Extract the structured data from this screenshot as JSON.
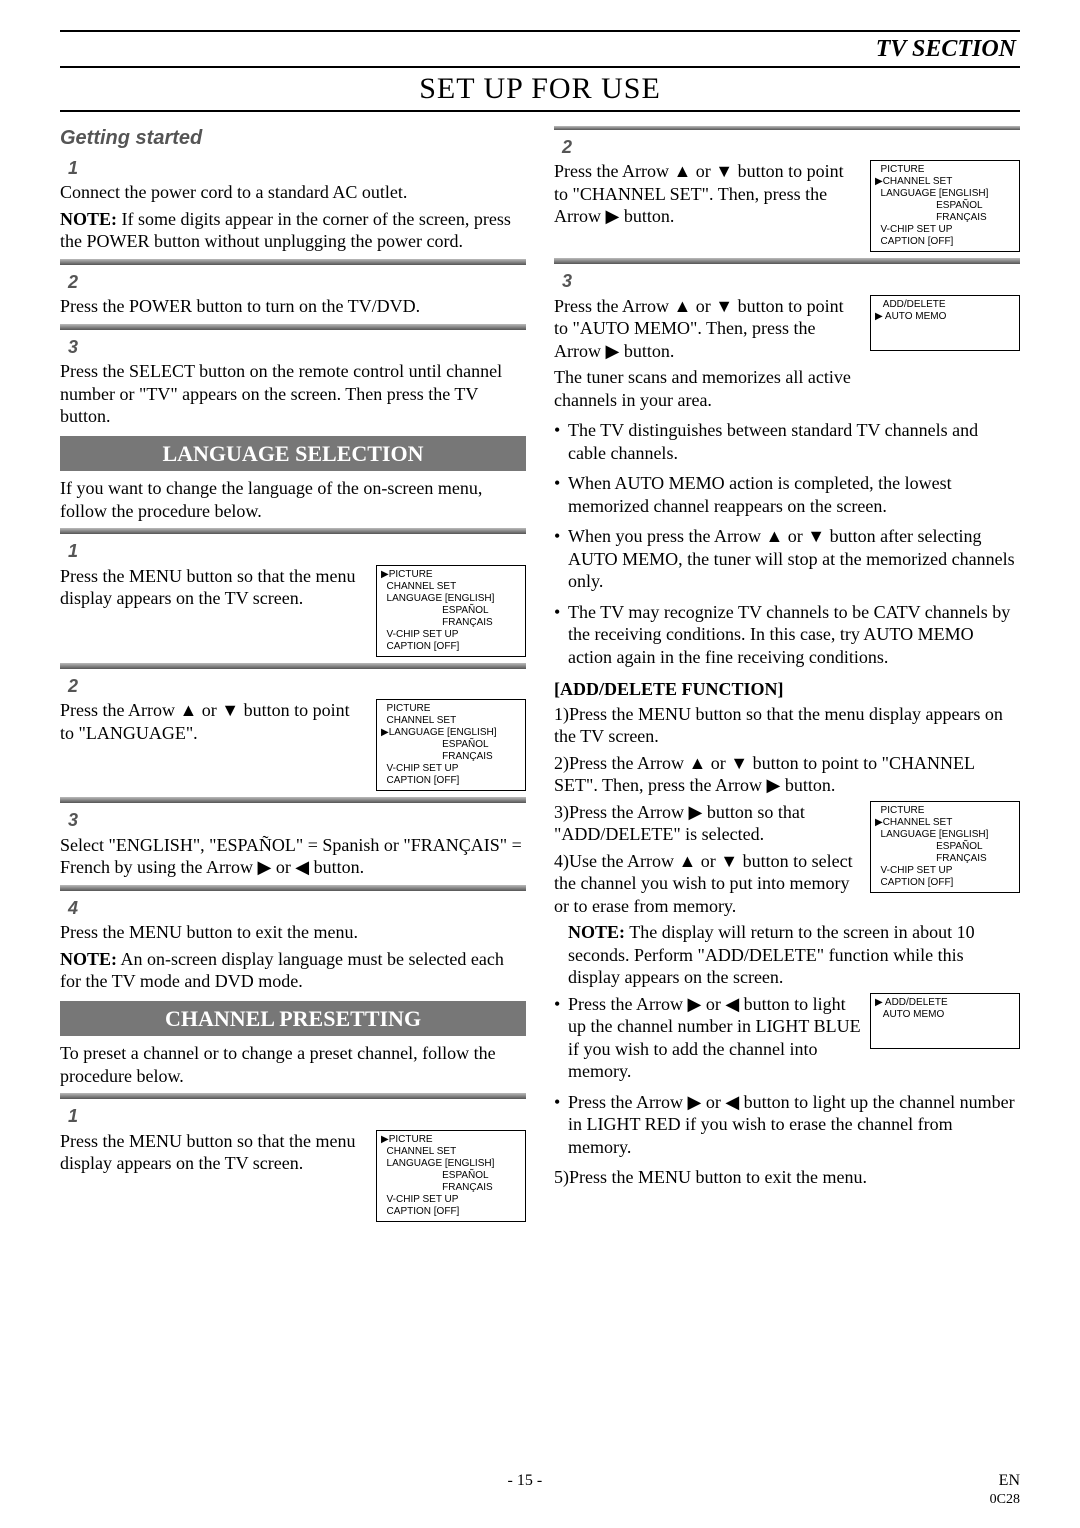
{
  "header": {
    "tv_section": "TV SECTION",
    "main_title": "SET UP FOR USE"
  },
  "left": {
    "getting_started": "Getting started",
    "s1": "1",
    "p1a": "Connect the power cord to a standard AC outlet.",
    "p1b": "NOTE: If some digits appear in the corner of the screen, press the POWER button without unplugging the power cord.",
    "s2": "2",
    "p2": "Press the POWER button to turn on the TV/DVD.",
    "s3": "3",
    "p3a": "Press the SELECT button on the remote control until channel number or \"TV\" appears on the screen. Then press the TV button.",
    "banner_lang": "LANGUAGE SELECTION",
    "lang_intro": "If you want to change the language of the on-screen menu, follow the procedure below.",
    "ls1": "1",
    "lp1": "Press the MENU button so that the menu display appears on the TV screen.",
    "ls2": "2",
    "lp2": "Press the Arrow ▲ or ▼ button to point to \"LANGUAGE\".",
    "ls3": "3",
    "lp3": "Select \"ENGLISH\", \"ESPAÑOL\" = Spanish or \"FRANÇAIS\" = French by using the Arrow ▶ or ◀ button.",
    "ls4": "4",
    "lp4a": "Press the MENU button to exit the menu.",
    "lp4b": "NOTE: An on-screen display language must be selected each for the TV mode and DVD mode.",
    "banner_chan": "CHANNEL PRESETTING",
    "cp_intro": "To preset a channel or to change a preset channel, follow the procedure below.",
    "cs1": "1",
    "cp1": "Press the MENU button so that the menu display appears on the TV screen."
  },
  "right": {
    "cs2": "2",
    "cp2": "Press the Arrow ▲ or ▼ button to point to \"CHANNEL SET\". Then, press the Arrow ▶ button.",
    "cs3": "3",
    "cp3a": "Press the Arrow ▲ or ▼ button to point to \"AUTO MEMO\". Then, press the Arrow ▶ button.",
    "cp3b": "The tuner scans and memorizes all active channels in your area.",
    "b1": "The TV distinguishes between standard TV channels and cable channels.",
    "b2": "When AUTO MEMO action is completed, the lowest memorized channel reappears on the screen.",
    "b3": "When you press the Arrow ▲ or ▼ button after selecting AUTO MEMO, the tuner will stop at the memorized channels only.",
    "b4": "The TV may recognize TV channels to be CATV channels by the receiving conditions. In this case, try AUTO MEMO action again in the fine receiving conditions.",
    "add_head": "[ADD/DELETE FUNCTION]",
    "n1": "1)Press the MENU button so that the menu display appears on the TV screen.",
    "n2": "2)Press the Arrow ▲ or ▼ button to point to \"CHANNEL SET\".  Then, press the Arrow ▶ button.",
    "n3a": "3)Press the Arrow ▶ button so that \"ADD/DELETE\" is selected.",
    "n4a": "4)Use the Arrow ▲ or ▼ button to select the channel you wish to put into memory or to erase from memory.",
    "note4": "NOTE: The display will return to the screen in about 10 seconds. Perform \"ADD/DELETE\" function while this display appears on the screen.",
    "pb1": "Press the Arrow ▶ or ◀ button to light up the channel number in LIGHT BLUE if you wish to add the channel into memory.",
    "pb2": "Press the Arrow ▶ or ◀ button to light up the channel number in LIGHT RED if you wish to erase the channel from memory.",
    "n5": "5)Press the MENU button to exit the menu."
  },
  "menus": {
    "m_picture": "▶PICTURE\n  CHANNEL SET\n  LANGUAGE [ENGLISH]\n                      ESPAÑOL\n                      FRANÇAIS\n  V-CHIP SET UP\n  CAPTION [OFF]",
    "m_language": "  PICTURE\n  CHANNEL SET\n▶LANGUAGE [ENGLISH]\n                      ESPAÑOL\n                      FRANÇAIS\n  V-CHIP SET UP\n  CAPTION [OFF]",
    "m_channel": "  PICTURE\n▶CHANNEL SET\n  LANGUAGE [ENGLISH]\n                      ESPAÑOL\n                      FRANÇAIS\n  V-CHIP SET UP\n  CAPTION [OFF]",
    "m_automemo": "   ADD/DELETE\n▶ AUTO MEMO\n \n ",
    "m_adddelete": "▶ ADD/DELETE\n   AUTO MEMO\n \n "
  },
  "footer": {
    "page": "- 15 -",
    "en": "EN",
    "code": "0C28"
  }
}
